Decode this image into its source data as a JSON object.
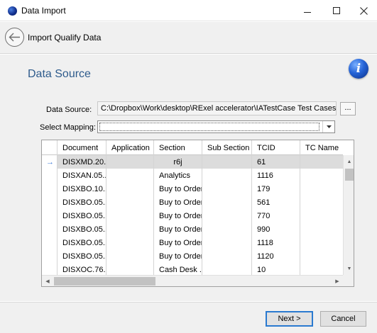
{
  "window": {
    "title": "Data Import",
    "icon": "app-globe-icon"
  },
  "nav": {
    "title": "Import Qualify Data",
    "back_icon": "back-arrow-icon"
  },
  "section": {
    "title": "Data Source",
    "info_icon": "info-icon",
    "info_glyph": "i"
  },
  "form": {
    "data_source_label": "Data Source:",
    "data_source_value": "C:\\Dropbox\\Work\\desktop\\RExel accelerator\\IATestCase Test Cases trunc",
    "browse_label": "...",
    "mapping_label": "Select Mapping:",
    "mapping_value": ""
  },
  "grid": {
    "columns": [
      "Document",
      "Application",
      "Section",
      "Sub Section",
      "TCID",
      "TC Name"
    ],
    "current_row_marker": "→",
    "rows": [
      [
        "DISXMD.20...",
        "",
        "r6j",
        "",
        "61",
        ""
      ],
      [
        "DISXAN.05...",
        "",
        "Analytics",
        "",
        "1116",
        ""
      ],
      [
        "DISXBO.10...",
        "",
        "Buy to Order",
        "",
        "179",
        ""
      ],
      [
        "DISXBO.05...",
        "",
        "Buy to Order",
        "",
        "561",
        ""
      ],
      [
        "DISXBO.05...",
        "",
        "Buy to Order",
        "",
        "770",
        ""
      ],
      [
        "DISXBO.05...",
        "",
        "Buy to Order",
        "",
        "990",
        ""
      ],
      [
        "DISXBO.05...",
        "",
        "Buy to Order",
        "",
        "1118",
        ""
      ],
      [
        "DISXBO.05...",
        "",
        "Buy to Order",
        "",
        "1120",
        ""
      ],
      [
        "DISXOC.76...",
        "",
        "Cash Desk ...",
        "",
        "10",
        ""
      ]
    ]
  },
  "footer": {
    "next_label": "Next >",
    "cancel_label": "Cancel"
  },
  "colors": {
    "section_title": "#2e5b8c",
    "selected_row": "#dcdcdc",
    "default_button_border": "#2a7ad0"
  }
}
